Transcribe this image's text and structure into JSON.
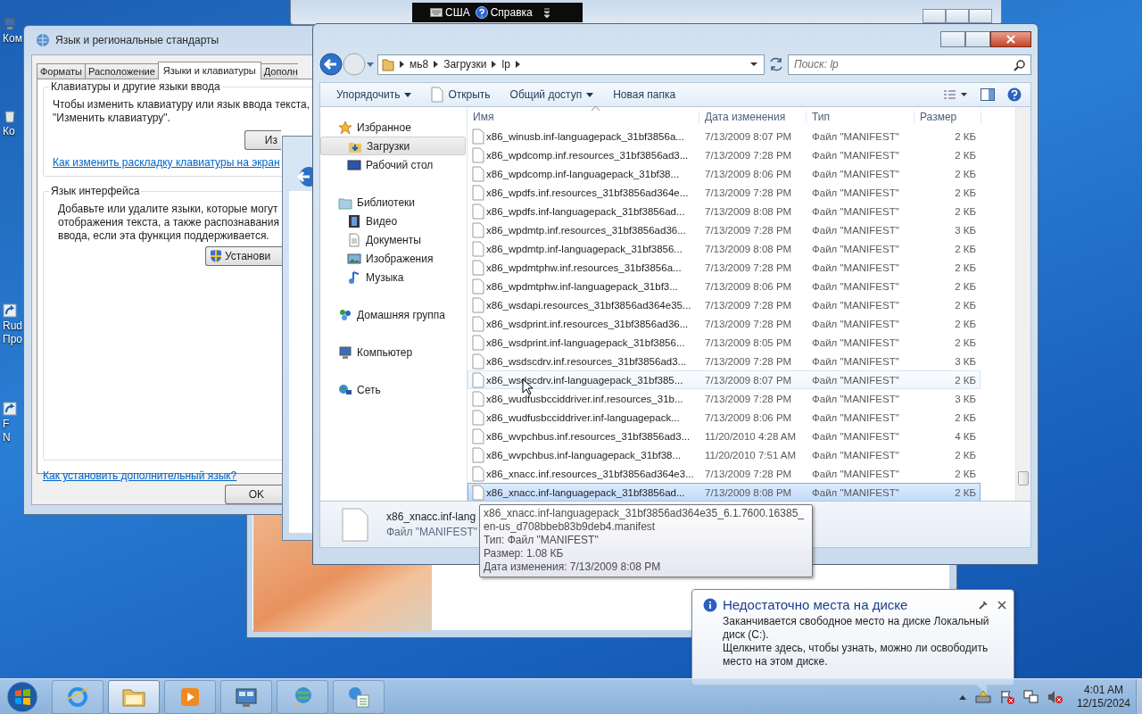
{
  "desktop": {
    "icons": [
      {
        "kind": "computer",
        "label": "Ком"
      },
      {
        "kind": "recycle-bin",
        "label": "Ко"
      },
      {
        "kind": "shortcut",
        "label": "Rud\nПро"
      },
      {
        "kind": "shortcut",
        "label": "F\nN"
      }
    ]
  },
  "language_bar": {
    "layout": "США",
    "help": "Справка"
  },
  "language_dialog": {
    "title": "Язык и региональные стандарты",
    "tabs": [
      {
        "label": "Форматы",
        "selected": false
      },
      {
        "label": "Расположение",
        "selected": false
      },
      {
        "label": "Языки и клавиатуры",
        "selected": true
      },
      {
        "label": "Дополн",
        "selected": false
      }
    ],
    "keyboards_group": {
      "title": "Клавиатуры и другие языки ввода",
      "text": "Чтобы изменить клавиатуру или язык ввода текста,\n\"Изменить клавиатуру\".",
      "button": "Из",
      "link": "Как изменить раскладку клавиатуры на экран"
    },
    "interface_group": {
      "title": "Язык интерфейса",
      "text": "Добавьте или удалите языки, которые могут\nотображения текста, а также распознавания\nввода, если эта функция поддерживается.",
      "button": "Установи"
    },
    "link": "Как установить дополнительный язык?",
    "ok_button": "OK"
  },
  "explorer": {
    "breadcrumb": [
      "мь8",
      "Загрузки",
      "lp"
    ],
    "search": {
      "placeholder": "Поиск: lp"
    },
    "toolbar": [
      {
        "label": "Упорядочить",
        "kind": "menu"
      },
      {
        "label": "Открыть",
        "kind": "open"
      },
      {
        "label": "Общий доступ",
        "kind": "menu"
      },
      {
        "label": "Новая папка",
        "kind": "plain"
      }
    ],
    "navigation": [
      {
        "label": "Избранное",
        "kind": "favorites",
        "selected": false,
        "children": [
          {
            "label": "Загрузки",
            "kind": "downloads",
            "selected": true
          },
          {
            "label": "Рабочий стол",
            "kind": "desktop",
            "selected": false
          }
        ]
      },
      {
        "label": "Библиотеки",
        "kind": "libraries",
        "selected": false,
        "children": [
          {
            "label": "Видео",
            "kind": "video",
            "selected": false
          },
          {
            "label": "Документы",
            "kind": "documents",
            "selected": false
          },
          {
            "label": "Изображения",
            "kind": "pictures",
            "selected": false
          },
          {
            "label": "Музыка",
            "kind": "music",
            "selected": false
          }
        ]
      },
      {
        "label": "Домашняя группа",
        "kind": "homegroup",
        "selected": false
      },
      {
        "label": "Компьютер",
        "kind": "computer",
        "selected": false
      },
      {
        "label": "Сеть",
        "kind": "network",
        "selected": false
      }
    ],
    "columns": [
      "Имя",
      "Дата изменения",
      "Тип",
      "Размер"
    ],
    "rows": [
      {
        "name": "x86_winusb.inf-languagepack_31bf3856a...",
        "date": "7/13/2009 8:07 PM",
        "type": "Файл \"MANIFEST\"",
        "size": "2 КБ",
        "selected": false,
        "hovered": false
      },
      {
        "name": "x86_wpdcomp.inf.resources_31bf3856ad3...",
        "date": "7/13/2009 7:28 PM",
        "type": "Файл \"MANIFEST\"",
        "size": "2 КБ",
        "selected": false,
        "hovered": false
      },
      {
        "name": "x86_wpdcomp.inf-languagepack_31bf38...",
        "date": "7/13/2009 8:06 PM",
        "type": "Файл \"MANIFEST\"",
        "size": "2 КБ",
        "selected": false,
        "hovered": false
      },
      {
        "name": "x86_wpdfs.inf.resources_31bf3856ad364e...",
        "date": "7/13/2009 7:28 PM",
        "type": "Файл \"MANIFEST\"",
        "size": "2 КБ",
        "selected": false,
        "hovered": false
      },
      {
        "name": "x86_wpdfs.inf-languagepack_31bf3856ad...",
        "date": "7/13/2009 8:08 PM",
        "type": "Файл \"MANIFEST\"",
        "size": "2 КБ",
        "selected": false,
        "hovered": false
      },
      {
        "name": "x86_wpdmtp.inf.resources_31bf3856ad36...",
        "date": "7/13/2009 7:28 PM",
        "type": "Файл \"MANIFEST\"",
        "size": "3 КБ",
        "selected": false,
        "hovered": false
      },
      {
        "name": "x86_wpdmtp.inf-languagepack_31bf3856...",
        "date": "7/13/2009 8:08 PM",
        "type": "Файл \"MANIFEST\"",
        "size": "2 КБ",
        "selected": false,
        "hovered": false
      },
      {
        "name": "x86_wpdmtphw.inf.resources_31bf3856a...",
        "date": "7/13/2009 7:28 PM",
        "type": "Файл \"MANIFEST\"",
        "size": "2 КБ",
        "selected": false,
        "hovered": false
      },
      {
        "name": "x86_wpdmtphw.inf-languagepack_31bf3...",
        "date": "7/13/2009 8:06 PM",
        "type": "Файл \"MANIFEST\"",
        "size": "2 КБ",
        "selected": false,
        "hovered": false
      },
      {
        "name": "x86_wsdapi.resources_31bf3856ad364e35...",
        "date": "7/13/2009 7:28 PM",
        "type": "Файл \"MANIFEST\"",
        "size": "2 КБ",
        "selected": false,
        "hovered": false
      },
      {
        "name": "x86_wsdprint.inf.resources_31bf3856ad36...",
        "date": "7/13/2009 7:28 PM",
        "type": "Файл \"MANIFEST\"",
        "size": "2 КБ",
        "selected": false,
        "hovered": false
      },
      {
        "name": "x86_wsdprint.inf-languagepack_31bf3856...",
        "date": "7/13/2009 8:05 PM",
        "type": "Файл \"MANIFEST\"",
        "size": "2 КБ",
        "selected": false,
        "hovered": false
      },
      {
        "name": "x86_wsdscdrv.inf.resources_31bf3856ad3...",
        "date": "7/13/2009 7:28 PM",
        "type": "Файл \"MANIFEST\"",
        "size": "3 КБ",
        "selected": false,
        "hovered": false
      },
      {
        "name": "x86_wsdscdrv.inf-languagepack_31bf385...",
        "date": "7/13/2009 8:07 PM",
        "type": "Файл \"MANIFEST\"",
        "size": "2 КБ",
        "selected": false,
        "hovered": true
      },
      {
        "name": "x86_wudfusbcciddriver.inf.resources_31b...",
        "date": "7/13/2009 7:28 PM",
        "type": "Файл \"MANIFEST\"",
        "size": "3 КБ",
        "selected": false,
        "hovered": false
      },
      {
        "name": "x86_wudfusbcciddriver.inf-languagepack...",
        "date": "7/13/2009 8:06 PM",
        "type": "Файл \"MANIFEST\"",
        "size": "2 КБ",
        "selected": false,
        "hovered": false
      },
      {
        "name": "x86_wvpchbus.inf.resources_31bf3856ad3...",
        "date": "11/20/2010 4:28 AM",
        "type": "Файл \"MANIFEST\"",
        "size": "4 КБ",
        "selected": false,
        "hovered": false
      },
      {
        "name": "x86_wvpchbus.inf-languagepack_31bf38...",
        "date": "11/20/2010 7:51 AM",
        "type": "Файл \"MANIFEST\"",
        "size": "2 КБ",
        "selected": false,
        "hovered": false
      },
      {
        "name": "x86_xnacc.inf.resources_31bf3856ad364e3...",
        "date": "7/13/2009 7:28 PM",
        "type": "Файл \"MANIFEST\"",
        "size": "2 КБ",
        "selected": false,
        "hovered": false
      },
      {
        "name": "x86_xnacc.inf-languagepack_31bf3856ad...",
        "date": "7/13/2009 8:08 PM",
        "type": "Файл \"MANIFEST\"",
        "size": "2 КБ",
        "selected": true,
        "hovered": false
      }
    ],
    "details": {
      "name": "x86_xnacc.inf-lang",
      "type": "Файл \"MANIFEST\""
    }
  },
  "tooltip": {
    "name": "x86_xnacc.inf-languagepack_31bf3856ad364e35_6.1.7600.16385_en-us_d708bbeb83b9deb4.manifest",
    "lines": [
      "Тип: Файл \"MANIFEST\"",
      "Размер: 1.08 КБ",
      "Дата изменения: 7/13/2009 8:08 PM"
    ]
  },
  "notification": {
    "title": "Недостаточно места на диске",
    "text": "Заканчивается свободное место на диске Локальный диск (C:).",
    "action": "Щелкните здесь, чтобы узнать, можно ли освободить место на этом диске."
  },
  "taskbar": {
    "items": [
      {
        "kind": "browser",
        "active": false
      },
      {
        "kind": "folder",
        "active": true
      },
      {
        "kind": "media",
        "active": false
      },
      {
        "kind": "control",
        "active": false
      },
      {
        "kind": "globe",
        "active": false
      },
      {
        "kind": "globe-list",
        "active": false
      }
    ],
    "clock": {
      "time": "4:01 AM",
      "date": "12/15/2024"
    }
  }
}
